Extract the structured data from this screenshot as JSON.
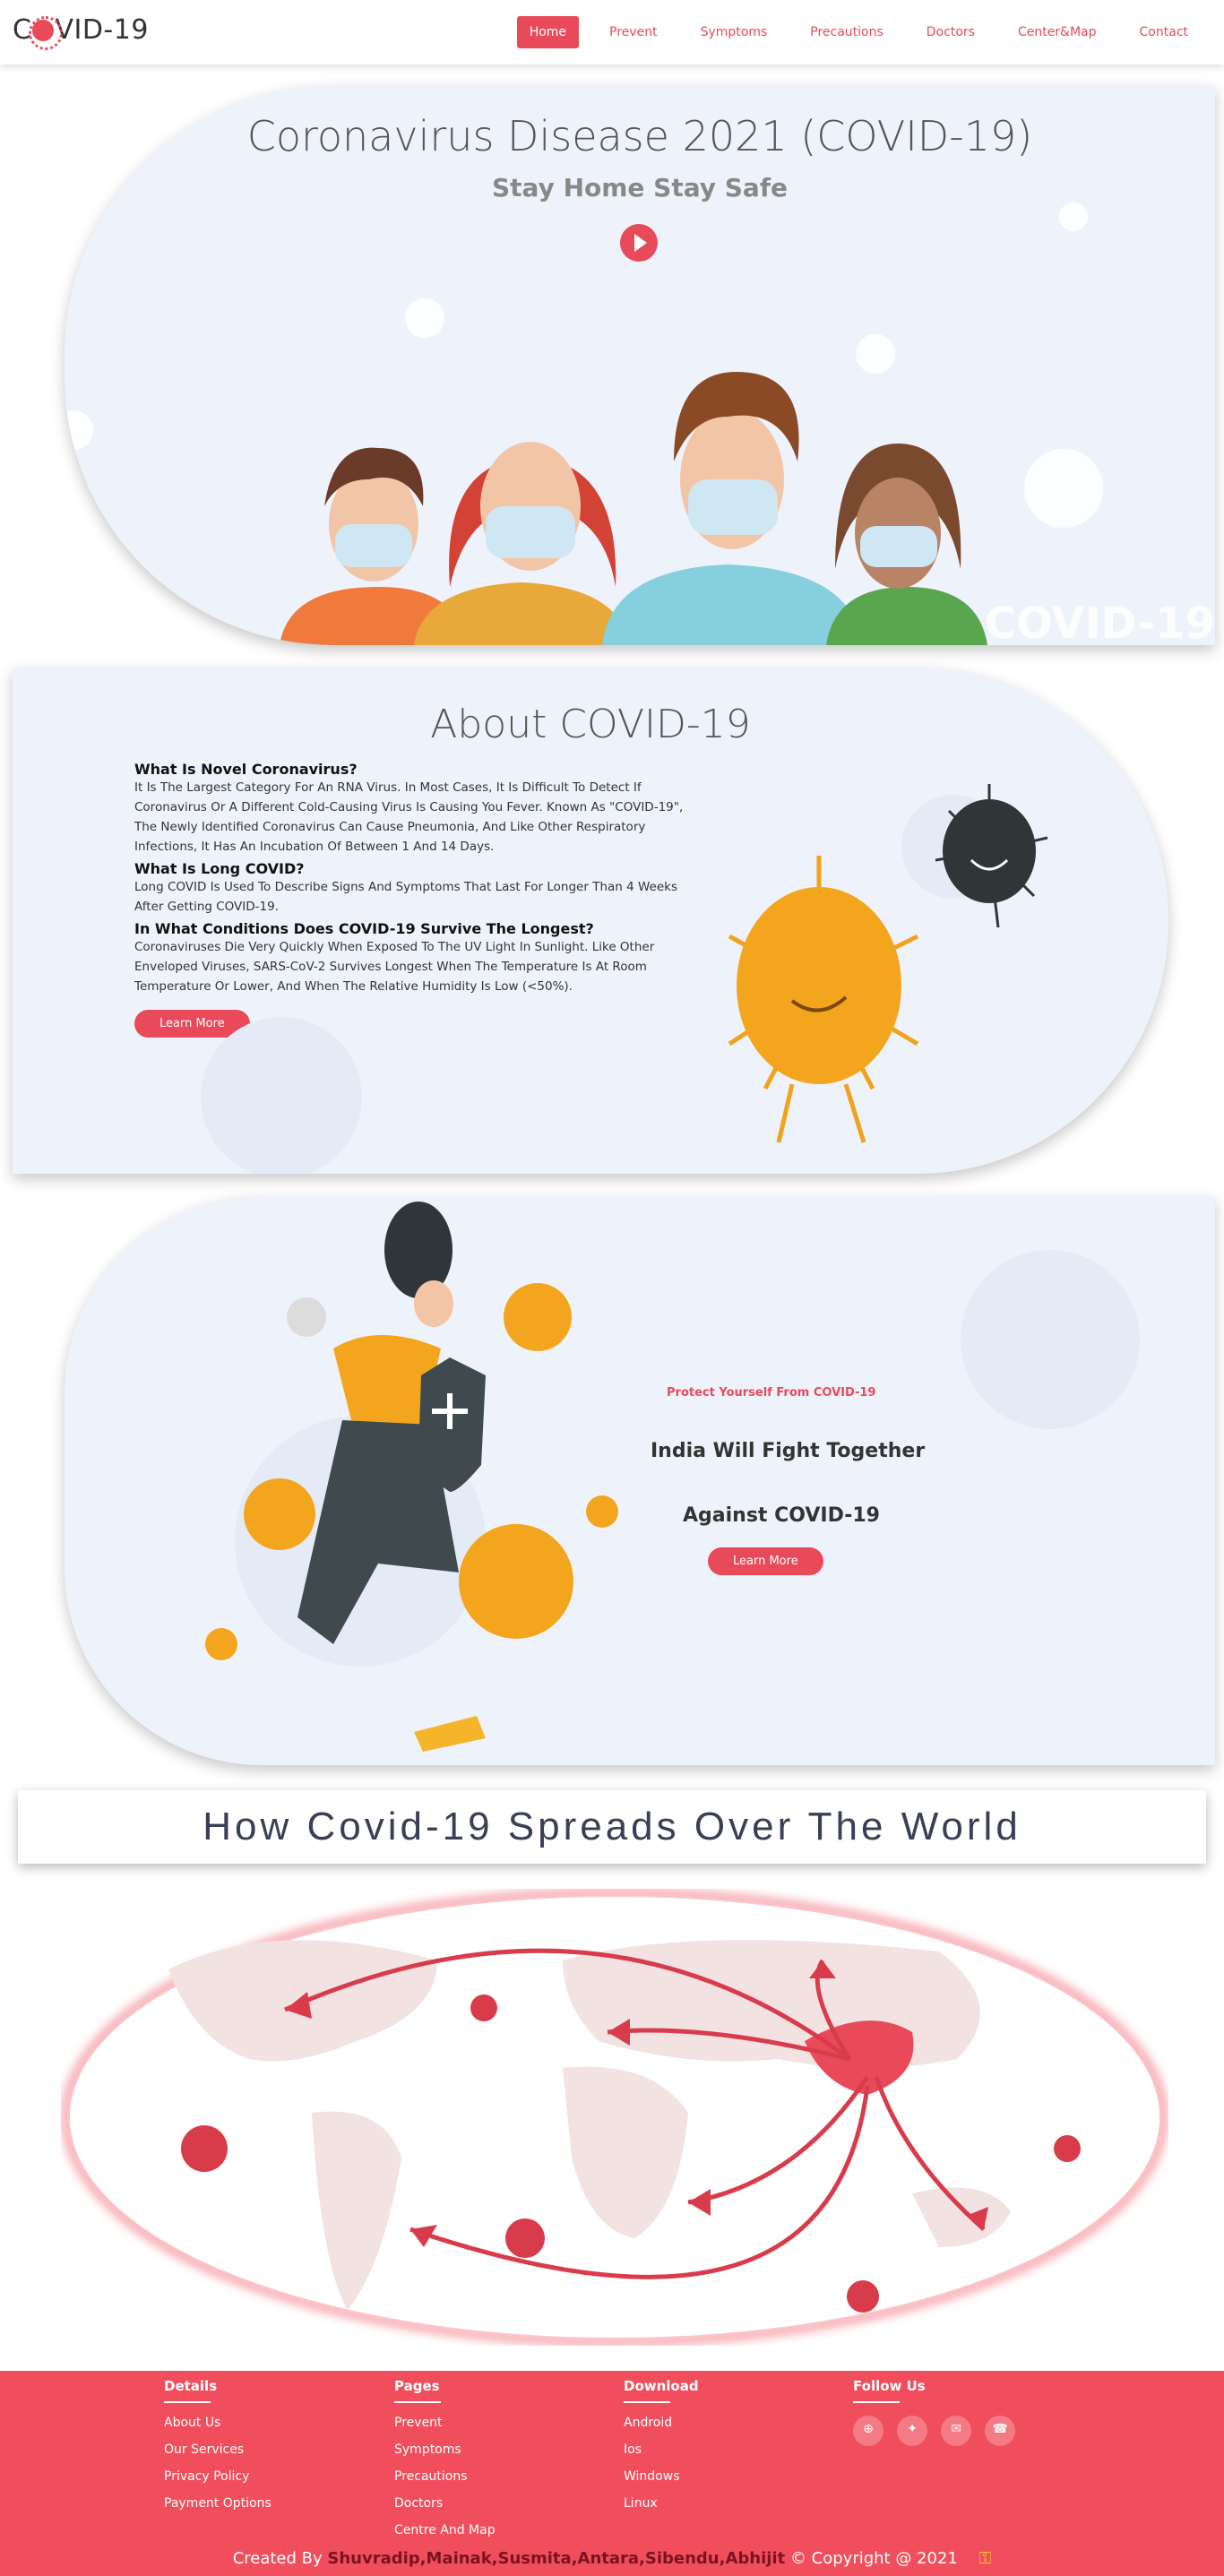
{
  "nav": {
    "logo": "COVID-19",
    "items": [
      {
        "label": "Home",
        "active": true
      },
      {
        "label": "Prevent"
      },
      {
        "label": "Symptoms"
      },
      {
        "label": "Precautions"
      },
      {
        "label": "Doctors"
      },
      {
        "label": "Center&Map"
      },
      {
        "label": "Contact"
      }
    ]
  },
  "hero": {
    "title": "Coronavirus Disease 2021 (COVID-19)",
    "subtitle": "Stay Home Stay Safe",
    "watermark": "COVID-19"
  },
  "about": {
    "title": "About COVID-19",
    "q1": "What Is Novel Coronavirus?",
    "a1": "It Is The Largest Category For An RNA Virus. In Most Cases, It Is Difficult To Detect If Coronavirus Or A Different Cold-Causing Virus Is Causing You Fever. Known As \"COVID-19\", The Newly Identified Coronavirus Can Cause Pneumonia, And Like Other Respiratory Infections, It Has An Incubation Of Between 1 And 14 Days.",
    "q2": "What Is Long COVID?",
    "a2": "Long COVID Is Used To Describe Signs And Symptoms That Last For Longer Than 4 Weeks After Getting COVID-19.",
    "q3": "In What Conditions Does COVID-19 Survive The Longest?",
    "a3": "Coronaviruses Die Very Quickly When Exposed To The UV Light In Sunlight. Like Other Enveloped Viruses, SARS-CoV-2 Survives Longest When The Temperature Is At Room Temperature Or Lower, And When The Relative Humidity Is Low (<50%).",
    "button": "Learn More"
  },
  "protect": {
    "tag": "Protect Yourself From COVID-19",
    "line1": "India Will Fight Together",
    "line2": "Against COVID-19",
    "button": "Learn More"
  },
  "spread": {
    "title": "How Covid-19 Spreads Over The World"
  },
  "footer": {
    "details": {
      "heading": "Details",
      "links": [
        "About Us",
        "Our Services",
        "Privacy Policy",
        "Payment Options"
      ]
    },
    "pages": {
      "heading": "Pages",
      "links": [
        "Prevent",
        "Symptoms",
        "Precautions",
        "Doctors",
        "Centre And Map"
      ]
    },
    "download": {
      "heading": "Download",
      "links": [
        "Android",
        "Ios",
        "Windows",
        "Linux"
      ]
    },
    "follow": {
      "heading": "Follow Us",
      "icons": [
        "globe-icon",
        "twitter-icon",
        "mail-icon",
        "phone-icon"
      ]
    },
    "credits_prefix": "Created By",
    "credits_names": "Shuvradip,Mainak,Susmita,Antara,Sibendu,Abhijit",
    "credits_suffix": "© Copyright @ 2021"
  },
  "colors": {
    "accent": "#e84a5a",
    "footer": "#f04e5c",
    "panel": "#eef3fb"
  }
}
